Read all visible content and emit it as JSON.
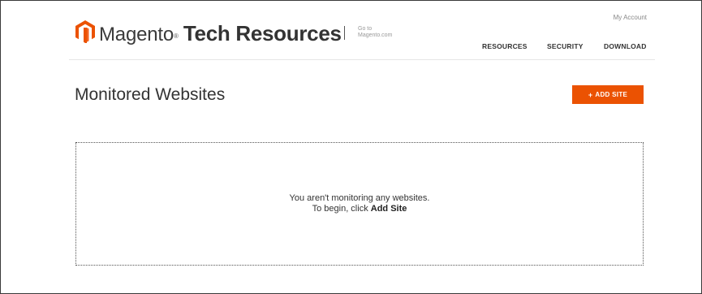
{
  "header": {
    "brand_name": "Magento",
    "brand_trademark": "®",
    "product_name": "Tech Resources",
    "goto_line1": "Go to",
    "goto_line2": "Magento.com",
    "my_account": "My Account",
    "nav": [
      {
        "label": "RESOURCES"
      },
      {
        "label": "SECURITY"
      },
      {
        "label": "DOWNLOAD"
      }
    ]
  },
  "main": {
    "title": "Monitored Websites",
    "add_site_icon": "+",
    "add_site_label": "ADD SITE",
    "empty_line1": "You aren't monitoring any websites.",
    "empty_line2_prefix": "To begin, click ",
    "empty_line2_action": "Add Site"
  },
  "colors": {
    "accent": "#eb5202",
    "text": "#333333"
  },
  "icons": {
    "logo": "magento-logo-icon"
  }
}
